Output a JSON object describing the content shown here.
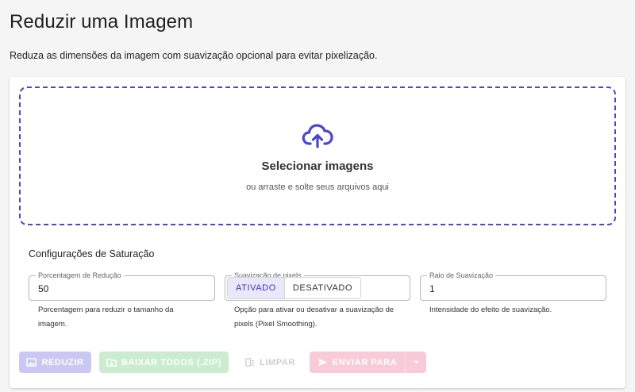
{
  "page": {
    "title": "Reduzir uma Imagem",
    "description": "Reduza as dimensões da imagem com suavização opcional para evitar pixelização."
  },
  "dropzone": {
    "icon": "cloud-upload-icon",
    "title": "Selecionar imagens",
    "subtitle": "ou arraste e solte seus arquivos aqui"
  },
  "settings": {
    "title": "Configurações de Saturação",
    "reduction": {
      "label": "Porcentagem de Redução",
      "value": "50",
      "helper": [
        "Porcentagem para reduzir o tamanho da",
        "imagem."
      ]
    },
    "smoothing": {
      "label": "Suavização de pixels",
      "options": [
        "ATIVADO",
        "DESATIVADO"
      ],
      "selected": "ATIVADO",
      "helper": [
        "Opção para ativar ou desativar a suavização de",
        "pixels (Pixel Smoothing)."
      ]
    },
    "radius": {
      "label": "Raio de Suavização",
      "value": "1",
      "helper": "Intensidade do efeito de suavização."
    }
  },
  "actions": {
    "reduce": "REDUZIR",
    "download_all": "BAIXAR TODOS (.ZIP)",
    "clear": "LIMPAR",
    "send_to": "ENVIAR PARA"
  },
  "colors": {
    "accent": "#4a47c9",
    "reduce_disabled": "#c9c7f3",
    "download_disabled": "#cbeccf",
    "send_disabled": "#f9cbd8"
  }
}
